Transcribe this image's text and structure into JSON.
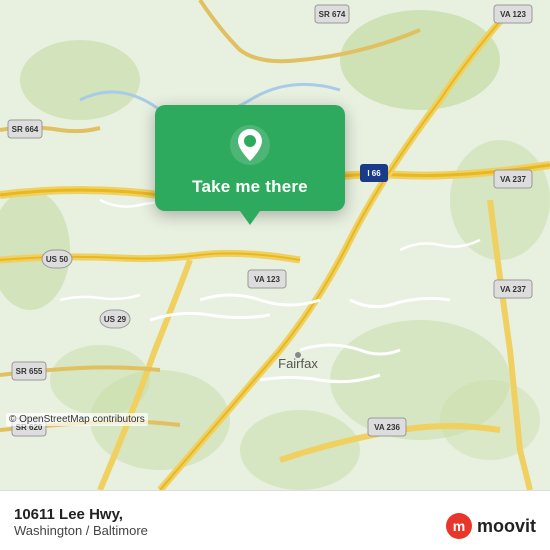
{
  "map": {
    "attribution": "© OpenStreetMap contributors",
    "background_color": "#e8f0e0"
  },
  "popup": {
    "label": "Take me there",
    "pin_color": "#ffffff"
  },
  "bottom_bar": {
    "address": "10611 Lee Hwy,",
    "city": "Washington / Baltimore"
  },
  "moovit": {
    "text": "moovit"
  },
  "road_labels": [
    "SR 674",
    "VA 123",
    "SR 664",
    "I 66",
    "VA 237",
    "US 50",
    "VA 123",
    "US 29",
    "SR 655",
    "SR 620",
    "VA 236",
    "Fairfax"
  ]
}
